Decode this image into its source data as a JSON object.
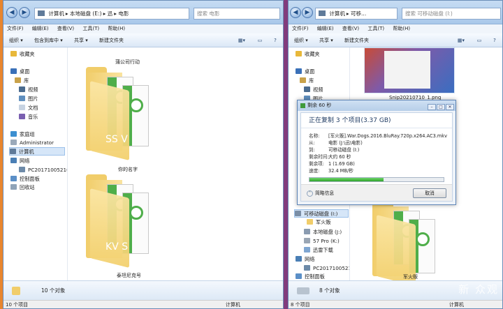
{
  "left_window": {
    "address": [
      "计算机",
      "本地磁盘 (E:)",
      "迅",
      "电影"
    ],
    "search_placeholder": "搜索 电影",
    "menu": [
      "文件(F)",
      "编辑(E)",
      "查看(V)",
      "工具(T)",
      "帮助(H)"
    ],
    "commands": [
      "组织 ▾",
      "包含到库中 ▾",
      "共享 ▾",
      "新建文件夹"
    ],
    "nav_items": [
      "收藏夹",
      "桌面",
      "库",
      "视频",
      "图片",
      "文档",
      "音乐",
      "家庭组",
      "Administrator",
      "计算机",
      "网络",
      "PC201710052108",
      "控制面板",
      "回收站"
    ],
    "folders": [
      "蒲公司行动",
      "你的名字",
      "泰坦尼克号"
    ],
    "folder_letters": [
      "SS V",
      "KV S"
    ],
    "status_count": "10 个对象",
    "status_bottom_left": "10 个项目",
    "status_bottom_right": "计算机"
  },
  "right_window": {
    "address": [
      "计算机",
      "可移..."
    ],
    "search_placeholder": "搜索 可移动磁盘 (I:)",
    "menu": [
      "文件(F)",
      "编辑(E)",
      "查看(V)",
      "工具(T)",
      "帮助(H)"
    ],
    "commands": [
      "组织 ▾",
      "共享 ▾",
      "新建文件夹"
    ],
    "nav_items": [
      "收藏夹",
      "桌面",
      "库",
      "视频",
      "图片",
      "可移动磁盘 (I:)",
      "军火贩",
      "本地磁盘 (J:)",
      "57 Pro (K:)",
      "迅雷下载",
      "网络",
      "PC201710052108",
      "控制面板"
    ],
    "thumb_label": "Snip20210710_1.png",
    "folder_label": "军火贩",
    "status_count": "8 个对象",
    "status_bottom_left": "8 个项目",
    "status_bottom_right": "计算机"
  },
  "dialog": {
    "title": "剩余 60 秒",
    "heading": "正在复制 3 个项目(3.37 GB)",
    "rows": [
      {
        "k": "名称:",
        "v": "[军火贩].War.Dogs.2016.BluRay.720p.x264.AC3.mkv"
      },
      {
        "k": "从:",
        "v": "电影 (J:\\迅\\电影)"
      },
      {
        "k": "到:",
        "v": "可移动磁盘 (I:)"
      },
      {
        "k": "剩余时间:",
        "v": "大约 60 秒"
      },
      {
        "k": "剩余项:",
        "v": "1 (1.69 GB)"
      },
      {
        "k": "速度:",
        "v": "32.4 MB/秒"
      }
    ],
    "progress": 0.55,
    "less_info": "简略信息",
    "cancel": "取消"
  },
  "watermark": "新 众观",
  "colors": {
    "progress": "#2fa42b",
    "folder": "#f1cd6a",
    "accent": "#4fae4a"
  }
}
